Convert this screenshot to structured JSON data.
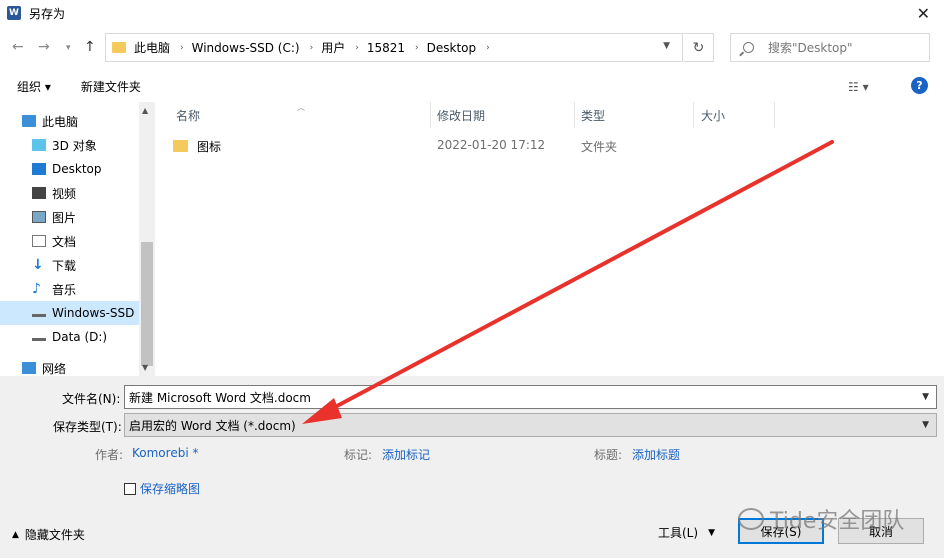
{
  "window": {
    "app_icon_letter": "W",
    "title": "另存为",
    "close_glyph": "✕"
  },
  "address_bar": {
    "crumbs": [
      "此电脑",
      "Windows-SSD (C:)",
      "用户",
      "15821",
      "Desktop"
    ],
    "search_placeholder": "搜索\"Desktop\""
  },
  "toolbar": {
    "organize_label": "组织 ▾",
    "new_folder_label": "新建文件夹",
    "view_glyph": "☷ ▾",
    "help_glyph": "?"
  },
  "sidebar": {
    "items": [
      {
        "label": "此电脑",
        "icon": "computer-icon"
      },
      {
        "label": "3D 对象",
        "icon": "3d-objects-icon"
      },
      {
        "label": "Desktop",
        "icon": "desktop-icon"
      },
      {
        "label": "视频",
        "icon": "video-icon"
      },
      {
        "label": "图片",
        "icon": "pictures-icon"
      },
      {
        "label": "文档",
        "icon": "documents-icon"
      },
      {
        "label": "下载",
        "icon": "download-icon"
      },
      {
        "label": "音乐",
        "icon": "music-icon"
      },
      {
        "label": "Windows-SSD",
        "icon": "drive-icon",
        "selected": true
      },
      {
        "label": "Data (D:)",
        "icon": "drive-icon"
      },
      {
        "label": "网络",
        "icon": "network-icon"
      }
    ]
  },
  "file_list": {
    "columns": [
      "名称",
      "修改日期",
      "类型",
      "大小"
    ],
    "rows": [
      {
        "name": "图标",
        "modified": "2022-01-20 17:12",
        "type": "文件夹",
        "size": ""
      }
    ]
  },
  "form": {
    "filename_label": "文件名(N):",
    "filename_value": "新建 Microsoft Word 文档.docm",
    "filetype_label": "保存类型(T):",
    "filetype_value": "启用宏的 Word 文档 (*.docm)",
    "author_label": "作者:",
    "author_value": "Komorebi *",
    "tags_label": "标记:",
    "tags_value": "添加标记",
    "title_label": "标题:",
    "title_value": "添加标题",
    "thumbnail_label": "保存缩略图",
    "thumbnail_checked": false
  },
  "footer": {
    "hide_folders_label": "隐藏文件夹",
    "tools_label": "工具(L)",
    "save_label": "保存(S)",
    "cancel_label": "取消"
  },
  "watermark": {
    "text": "Tide安全团队"
  },
  "colors": {
    "accent": "#0078d7",
    "link": "#1a63c4",
    "annotation_arrow": "#e8322b",
    "folder": "#f4c95d",
    "selection": "#cce8ff"
  }
}
